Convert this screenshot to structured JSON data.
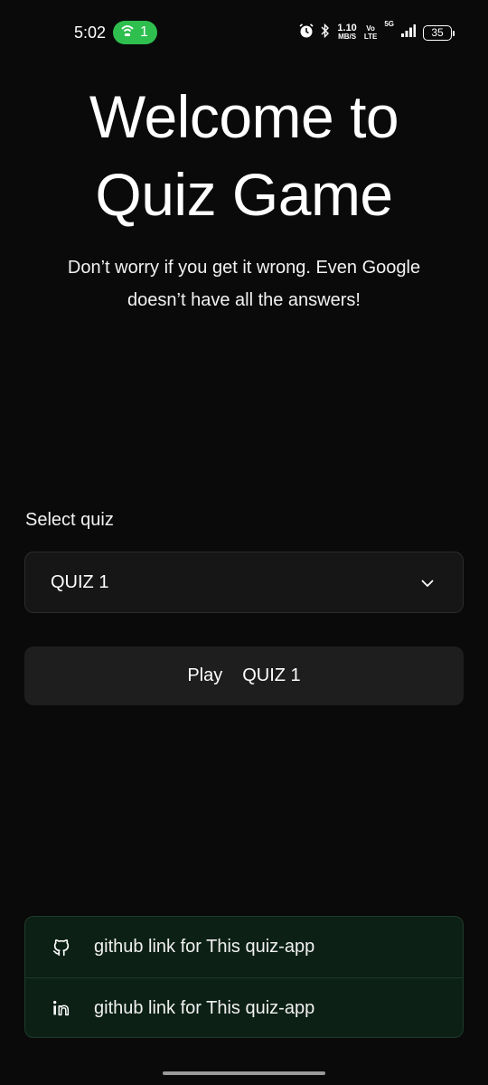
{
  "status_bar": {
    "time": "5:02",
    "hotspot_count": "1",
    "speed_value": "1.10",
    "speed_unit": "MB/S",
    "volte_top": "Vo",
    "volte_bottom": "LTE",
    "network": "5G",
    "battery": "35"
  },
  "header": {
    "title_line1": "Welcome to",
    "title_line2": "Quiz Game",
    "subtitle_line1": "Don’t worry if you get it wrong. Even Google",
    "subtitle_line2": "doesn’t have all the answers!"
  },
  "quiz_select": {
    "label": "Select quiz",
    "selected": "QUIZ 1"
  },
  "play_button": {
    "verb": "Play",
    "quiz": "QUIZ 1"
  },
  "links": [
    {
      "icon": "github-icon",
      "label": "github link for This quiz-app"
    },
    {
      "icon": "linkedin-icon",
      "label": "github link for This quiz-app"
    }
  ],
  "colors": {
    "background": "#0a0a0a",
    "hotspot_green": "#2fbf4f",
    "links_panel": "#0c2016"
  }
}
